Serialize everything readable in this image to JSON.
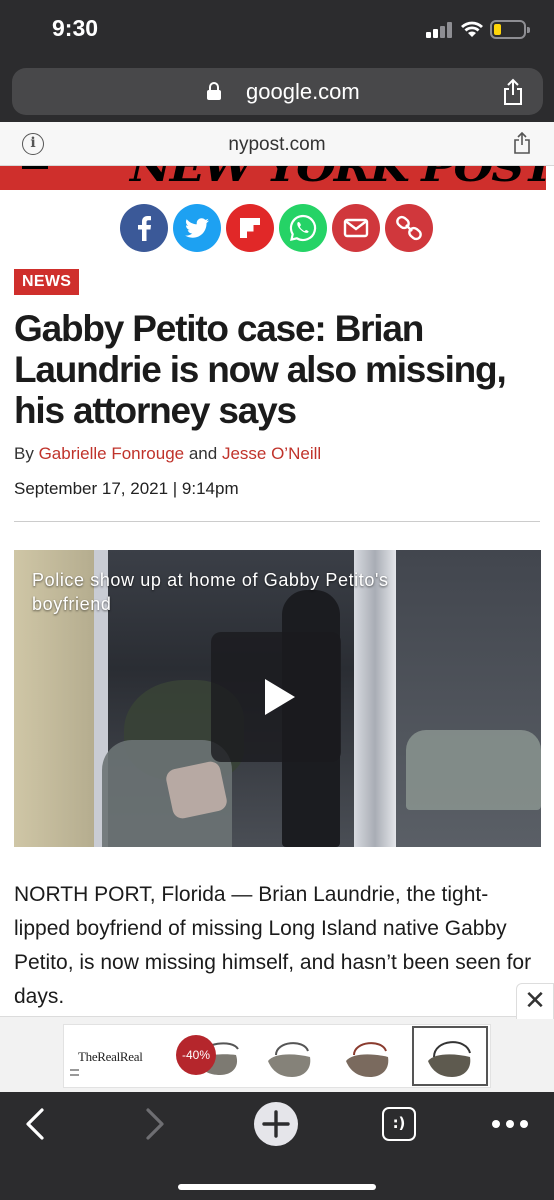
{
  "status_bar": {
    "time": "9:30",
    "battery_level": 0.25,
    "battery_color": "#ffd60a"
  },
  "browser": {
    "url": "google.com",
    "lock_icon": "lock-icon",
    "share_icon": "share-icon"
  },
  "in_app_bar": {
    "domain": "nypost.com",
    "info_icon_glyph": "i",
    "share_icon": "share-icon"
  },
  "masthead": {
    "brand_color": "#cf2f2c"
  },
  "share_buttons": [
    {
      "name": "facebook",
      "icon": "facebook-icon",
      "color": "#3b5998"
    },
    {
      "name": "twitter",
      "icon": "twitter-icon",
      "color": "#1da1f2"
    },
    {
      "name": "flipboard",
      "icon": "flipboard-icon",
      "color": "#e12828"
    },
    {
      "name": "whatsapp",
      "icon": "whatsapp-icon",
      "color": "#25d366"
    },
    {
      "name": "email",
      "icon": "email-icon",
      "color": "#d0373c"
    },
    {
      "name": "copy-link",
      "icon": "link-icon",
      "color": "#d0373c"
    }
  ],
  "article": {
    "section_tag": "NEWS",
    "headline": "Gabby Petito case: Brian Laundrie is now also missing, his attorney says",
    "byline_prefix": "By",
    "author_1": "Gabrielle Fonrouge",
    "byline_joiner": "and",
    "author_2": "Jesse O’Neill",
    "date": "September 17, 2021 | 9:14pm",
    "video_caption": "Police show up at home of Gabby Petito's boyfriend",
    "video_play_icon": "play-icon",
    "body_paragraph": "NORTH PORT, Florida — Brian Laundrie, the tight-lipped boyfriend of missing Long Island native Gabby Petito, is now missing himself, and hasn’t been seen for days."
  },
  "ad": {
    "close_glyph": "✕",
    "brand": "TheRealReal",
    "discount": "-40%"
  },
  "toolbar": {
    "back_icon": "chevron-left-icon",
    "forward_icon": "chevron-right-icon",
    "new_tab_icon": "plus-icon",
    "tabs_icon_label": ":)",
    "more_icon": "more-icon"
  }
}
